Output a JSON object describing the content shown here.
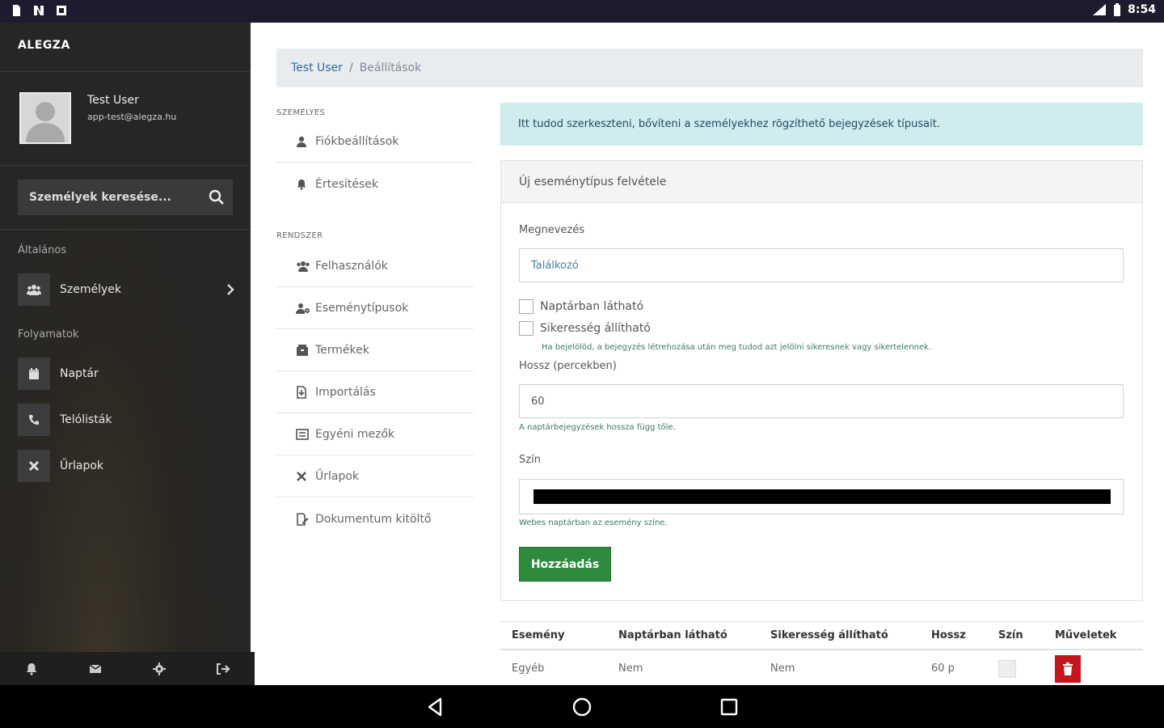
{
  "status_bar": {
    "time": "8:54"
  },
  "sidebar": {
    "brand": "ALEGZA",
    "user": {
      "name": "Test User",
      "email": "app-test@alegza.hu"
    },
    "search": {
      "placeholder": "Személyek keresése..."
    },
    "sections": [
      {
        "label": "Általános",
        "items": [
          {
            "label": "Személyek",
            "icon": "users-icon"
          }
        ]
      },
      {
        "label": "Folyamatok",
        "items": [
          {
            "label": "Naptár",
            "icon": "calendar-icon"
          },
          {
            "label": "Telólisták",
            "icon": "phone-icon"
          },
          {
            "label": "Űrlapok",
            "icon": "tools-icon"
          }
        ]
      }
    ],
    "bottom_icons": [
      "bell-icon",
      "mail-icon",
      "gear-icon",
      "logout-icon"
    ]
  },
  "breadcrumb": {
    "home": "Test User",
    "separator": "/",
    "current": "Beállítások"
  },
  "settings_nav": {
    "personal_heading": "SZEMÉLYES",
    "personal_items": [
      {
        "label": "Fiókbeállítások",
        "icon": "user-icon"
      },
      {
        "label": "Értesítések",
        "icon": "bell-icon"
      }
    ],
    "system_heading": "RENDSZER",
    "system_items": [
      {
        "label": "Felhasználók",
        "icon": "users-icon"
      },
      {
        "label": "Eseménytípusok",
        "icon": "user-cog-icon"
      },
      {
        "label": "Termékek",
        "icon": "box-icon"
      },
      {
        "label": "Importálás",
        "icon": "import-icon"
      },
      {
        "label": "Egyéni mezők",
        "icon": "fields-icon"
      },
      {
        "label": "Űrlapok",
        "icon": "tools-icon"
      },
      {
        "label": "Dokumentum kitöltő",
        "icon": "edit-doc-icon"
      }
    ]
  },
  "alert": {
    "text": "Itt tudod szerkeszteni, bővíteni a személyekhez rögzíthető bejegyzések típusait."
  },
  "form": {
    "title": "Új eseménytípus felvétele",
    "name_label": "Megnevezés",
    "name_value": "Találkozó",
    "check_calendar": "Naptárban látható",
    "check_success": "Sikeresség állítható",
    "success_help": "Ha bejelölöd, a bejegyzés létrehozása után meg tudod azt jelölni sikeresnek vagy sikertelennek.",
    "length_label": "Hossz (percekben)",
    "length_value": "60",
    "length_help": "A naptárbejegyzések hossza függ tőle.",
    "color_label": "Szín",
    "color_value": "#000000",
    "color_help": "Webes naptárban az esemény színe.",
    "submit_label": "Hozzáadás"
  },
  "table": {
    "headers": [
      "Esemény",
      "Naptárban látható",
      "Sikeresség állítható",
      "Hossz",
      "Szín",
      "Műveletek"
    ],
    "rows": [
      {
        "event": "Egyéb",
        "calendar": "Nem",
        "success": "Nem",
        "length": "60 p",
        "color": "#eeeeee"
      }
    ]
  },
  "colors": {
    "accent_green": "#2e8b3e",
    "danger": "#c4161c",
    "alert_bg": "#d1ecf1",
    "sidebar_bg": "#262626"
  }
}
